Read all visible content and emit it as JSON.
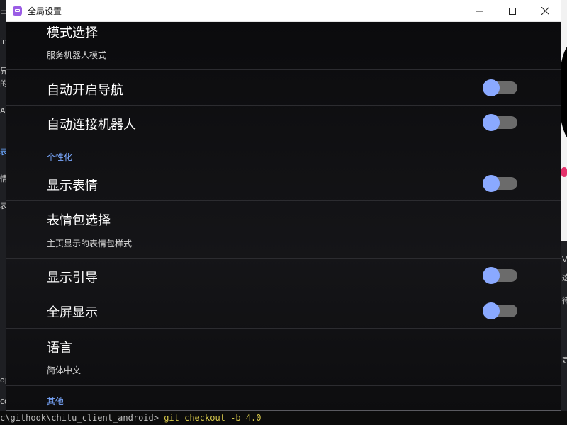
{
  "window": {
    "title": "全局设置",
    "app_icon": "settings-app-icon"
  },
  "settings": {
    "mode": {
      "label": "模式选择",
      "value": "服务机器人模式"
    },
    "auto_nav": {
      "label": "自动开启导航",
      "enabled": false
    },
    "auto_connect": {
      "label": "自动连接机器人",
      "enabled": false
    },
    "personal_header": "个性化",
    "show_expression": {
      "label": "显示表情",
      "enabled": false
    },
    "expression_pack": {
      "label": "表情包选择",
      "value": "主页显示的表情包样式"
    },
    "show_guide": {
      "label": "显示引导",
      "enabled": false
    },
    "fullscreen": {
      "label": "全屏显示",
      "enabled": false
    },
    "language": {
      "label": "语言",
      "value": "简体中文"
    },
    "other_header": "其他"
  },
  "terminal": {
    "prompt": "c\\githook\\chitu_client_android>",
    "command": "git checkout -b 4.0"
  },
  "background": {
    "left_fragments": [
      "中",
      "in",
      "界",
      "的",
      "A",
      "表",
      "情",
      "表",
      "op",
      "co"
    ],
    "right_fragments": [
      "V",
      "这",
      "待",
      "定"
    ]
  },
  "colors": {
    "accent": "#7aa8ff",
    "toggle_thumb": "#8aa9ff",
    "toggle_track": "#6b6b6b"
  }
}
